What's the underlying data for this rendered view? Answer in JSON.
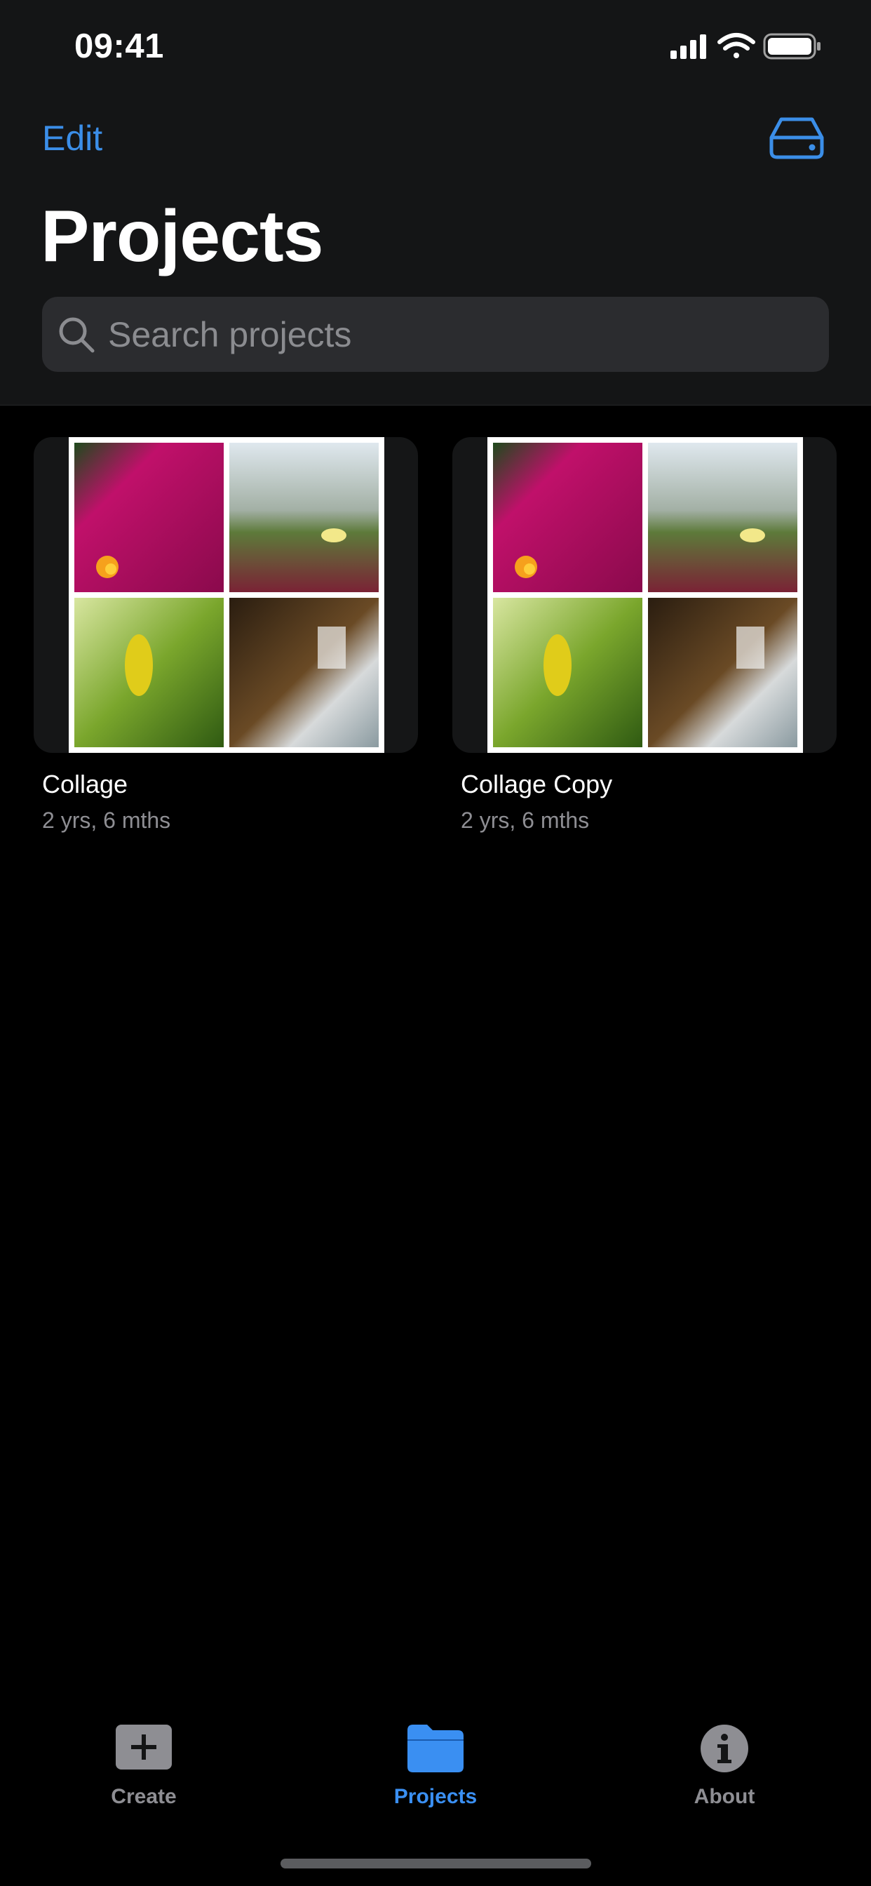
{
  "status_bar": {
    "time": "09:41"
  },
  "nav": {
    "edit_label": "Edit",
    "title": "Projects",
    "right_icon": "drive-icon"
  },
  "search": {
    "placeholder": "Search projects",
    "value": ""
  },
  "projects": [
    {
      "name": "Collage",
      "age": "2 yrs, 6 mths"
    },
    {
      "name": "Collage Copy",
      "age": "2 yrs, 6 mths"
    }
  ],
  "tabs": [
    {
      "label": "Create",
      "icon": "plus-square-icon",
      "active": false
    },
    {
      "label": "Projects",
      "icon": "folder-icon",
      "active": true
    },
    {
      "label": "About",
      "icon": "info-icon",
      "active": false
    }
  ],
  "colors": {
    "accent": "#3a8ff2",
    "background": "#000000",
    "header": "#141516"
  }
}
